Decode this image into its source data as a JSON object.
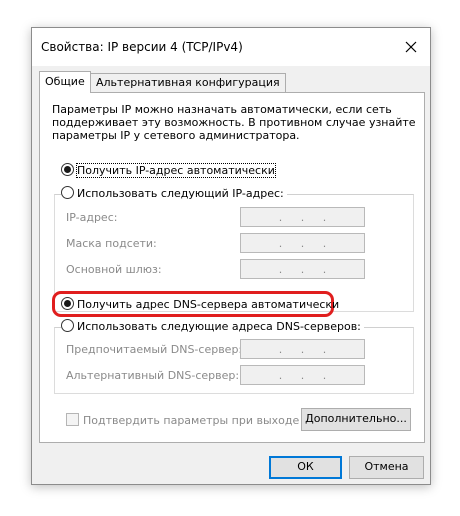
{
  "window": {
    "title": "Свойства: IP версии 4 (TCP/IPv4)"
  },
  "tabs": [
    {
      "label": "Общие",
      "active": true
    },
    {
      "label": "Альтернативная конфигурация",
      "active": false
    }
  ],
  "description": [
    "Параметры IP можно назначать автоматически, если сеть",
    "поддерживает эту возможность. В противном случае узнайте",
    "параметры IP у сетевого администратора."
  ],
  "ip_section": {
    "auto_option": "Получить IP-адрес автоматически",
    "manual_option": "Использовать следующий IP-адрес:",
    "fields": [
      {
        "label": "IP-адрес:",
        "value": ". . ."
      },
      {
        "label": "Маска подсети:",
        "value": ". . ."
      },
      {
        "label": "Основной шлюз:",
        "value": ". . ."
      }
    ]
  },
  "dns_section": {
    "auto_option": "Получить адрес DNS-сервера автоматически",
    "manual_option": "Использовать следующие адреса DNS-серверов:",
    "fields": [
      {
        "label": "Предпочитаемый DNS-сервер:",
        "value": ". . ."
      },
      {
        "label": "Альтернативный DNS-сервер:",
        "value": ". . ."
      }
    ]
  },
  "validate_checkbox": {
    "label": "Подтвердить параметры при выходе",
    "checked": false
  },
  "buttons": {
    "advanced": "Дополнительно...",
    "ok": "ОК",
    "cancel": "Отмена"
  },
  "colors": {
    "highlight": "#e01e1e",
    "accent": "#0078d7"
  }
}
